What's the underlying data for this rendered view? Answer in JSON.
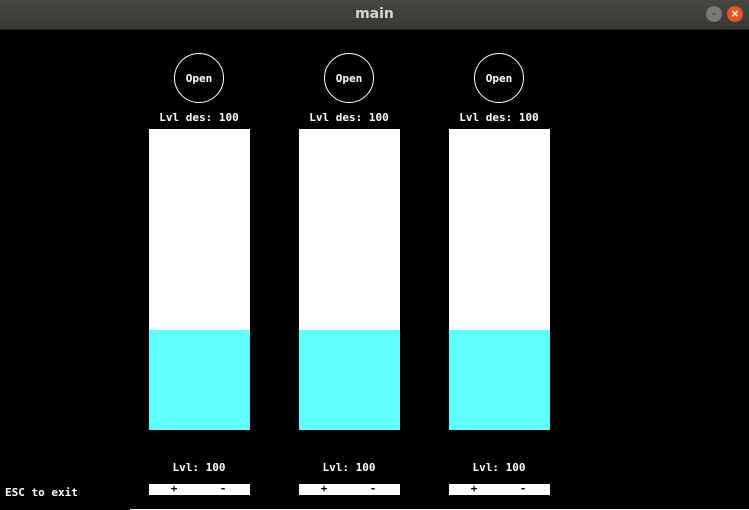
{
  "window": {
    "title": "main",
    "minimize_glyph": "–",
    "close_glyph": "×"
  },
  "tanks": [
    {
      "open_label": "Open",
      "desired_label": "Lvl des: 100",
      "level_label": "Lvl: 100",
      "fill_fraction": 0.333,
      "plus": "+",
      "minus": "-"
    },
    {
      "open_label": "Open",
      "desired_label": "Lvl des: 100",
      "level_label": "Lvl: 100",
      "fill_fraction": 0.333,
      "plus": "+",
      "minus": "-"
    },
    {
      "open_label": "Open",
      "desired_label": "Lvl des: 100",
      "level_label": "Lvl: 100",
      "fill_fraction": 0.333,
      "plus": "+",
      "minus": "-"
    }
  ],
  "footer": {
    "exit_hint": "ESC to exit"
  },
  "colors": {
    "background": "#000000",
    "tank_empty": "#ffffff",
    "tank_fill": "#5fffff"
  }
}
